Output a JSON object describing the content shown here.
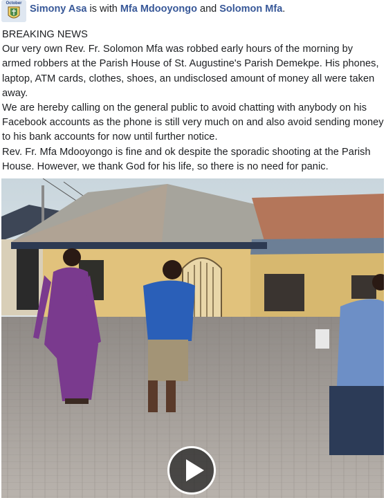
{
  "post": {
    "author": "Simony Asa",
    "with_text": "is with",
    "tagged": [
      "Mfa Mdooyongo",
      "Solomon Mfa"
    ],
    "and_text": "and",
    "period": ".",
    "avatar_label": "October",
    "paragraphs": [
      "BREAKING NEWS",
      "Our very own Rev. Fr. Solomon Mfa was robbed early hours of the morning by armed robbers at the Parish House of St. Augustine's Parish Demekpe. His phones, laptop, ATM cards, clothes, shoes, an undisclosed amount of money all were taken away.",
      "We are hereby calling on the general public to avoid chatting with anybody on his Facebook accounts as the phone is still very much on and also avoid sending money to his bank accounts for now until further notice.",
      "Rev. Fr. Mfa Mdooyongo is fine and ok despite the sporadic shooting at the Parish House. However, we thank God for his life, so there is no need for panic."
    ]
  },
  "video": {
    "play_icon": "play-icon",
    "accent": "#385898"
  }
}
